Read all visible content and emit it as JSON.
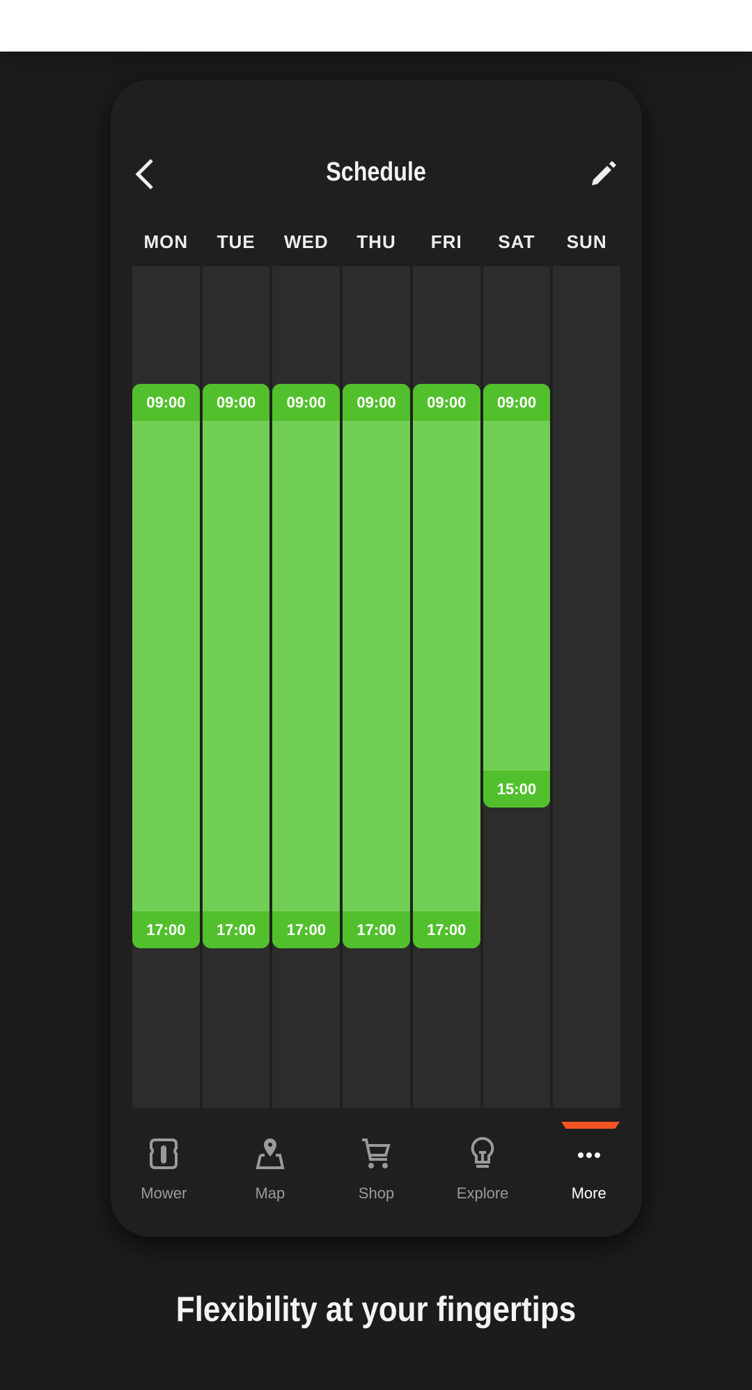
{
  "header": {
    "title": "Schedule",
    "back_icon": "chevron-left-icon",
    "edit_icon": "pencil-icon"
  },
  "days": [
    {
      "label": "MON",
      "start": "09:00",
      "end": "17:00"
    },
    {
      "label": "TUE",
      "start": "09:00",
      "end": "17:00"
    },
    {
      "label": "WED",
      "start": "09:00",
      "end": "17:00"
    },
    {
      "label": "THU",
      "start": "09:00",
      "end": "17:00"
    },
    {
      "label": "FRI",
      "start": "09:00",
      "end": "17:00"
    },
    {
      "label": "SAT",
      "start": "09:00",
      "end": "15:00"
    },
    {
      "label": "SUN",
      "start": null,
      "end": null
    }
  ],
  "nav": {
    "items": [
      {
        "label": "Mower",
        "icon": "mower-icon"
      },
      {
        "label": "Map",
        "icon": "map-pin-icon"
      },
      {
        "label": "Shop",
        "icon": "cart-icon"
      },
      {
        "label": "Explore",
        "icon": "lightbulb-icon"
      },
      {
        "label": "More",
        "icon": "more-dots-icon",
        "active": true
      }
    ]
  },
  "colors": {
    "accent": "#f25522",
    "block": "#72cf55",
    "block_header": "#52c02d"
  },
  "caption": "Flexibility at your fingertips"
}
